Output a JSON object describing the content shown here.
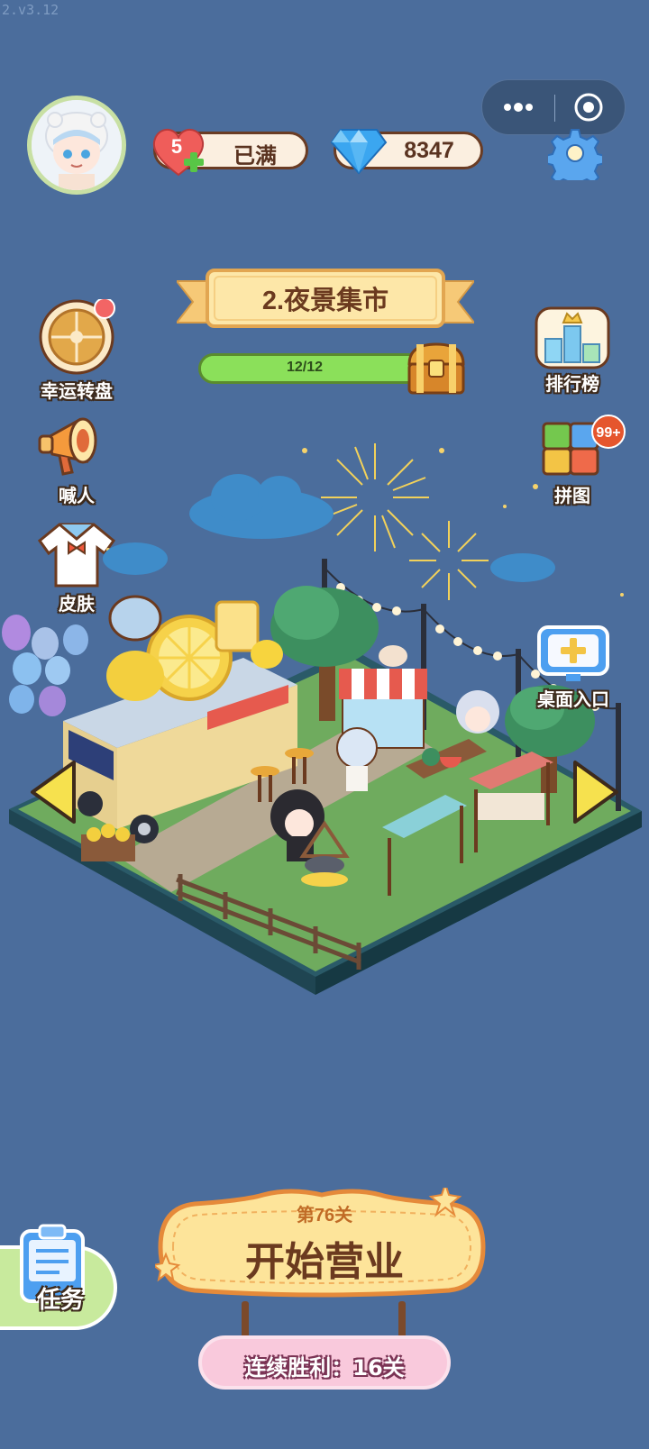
{
  "version": "2.v3.12",
  "hud": {
    "hearts": "5",
    "hearts_status": "已满",
    "gems": "8347"
  },
  "level": {
    "title": "2.夜景集市",
    "progress_text": "12/12",
    "progress_fraction": 1.0
  },
  "left_menu": [
    {
      "label": "幸运转盘"
    },
    {
      "label": "喊人"
    },
    {
      "label": "皮肤"
    }
  ],
  "right_menu": [
    {
      "label": "排行榜"
    },
    {
      "label": "拼图",
      "badge": "99+"
    },
    {
      "label": "桌面入口"
    }
  ],
  "bottom": {
    "task_label": "任务",
    "stage_label": "第76关",
    "start_label": "开始营业",
    "streak_label": "连续胜利：16关"
  },
  "colors": {
    "background": "#4b6d9c",
    "progress_green": "#7ed34b",
    "banner_bg": "#fde7a8",
    "start_pill": "#fde49a",
    "streak_pink": "#f9c9dc"
  }
}
